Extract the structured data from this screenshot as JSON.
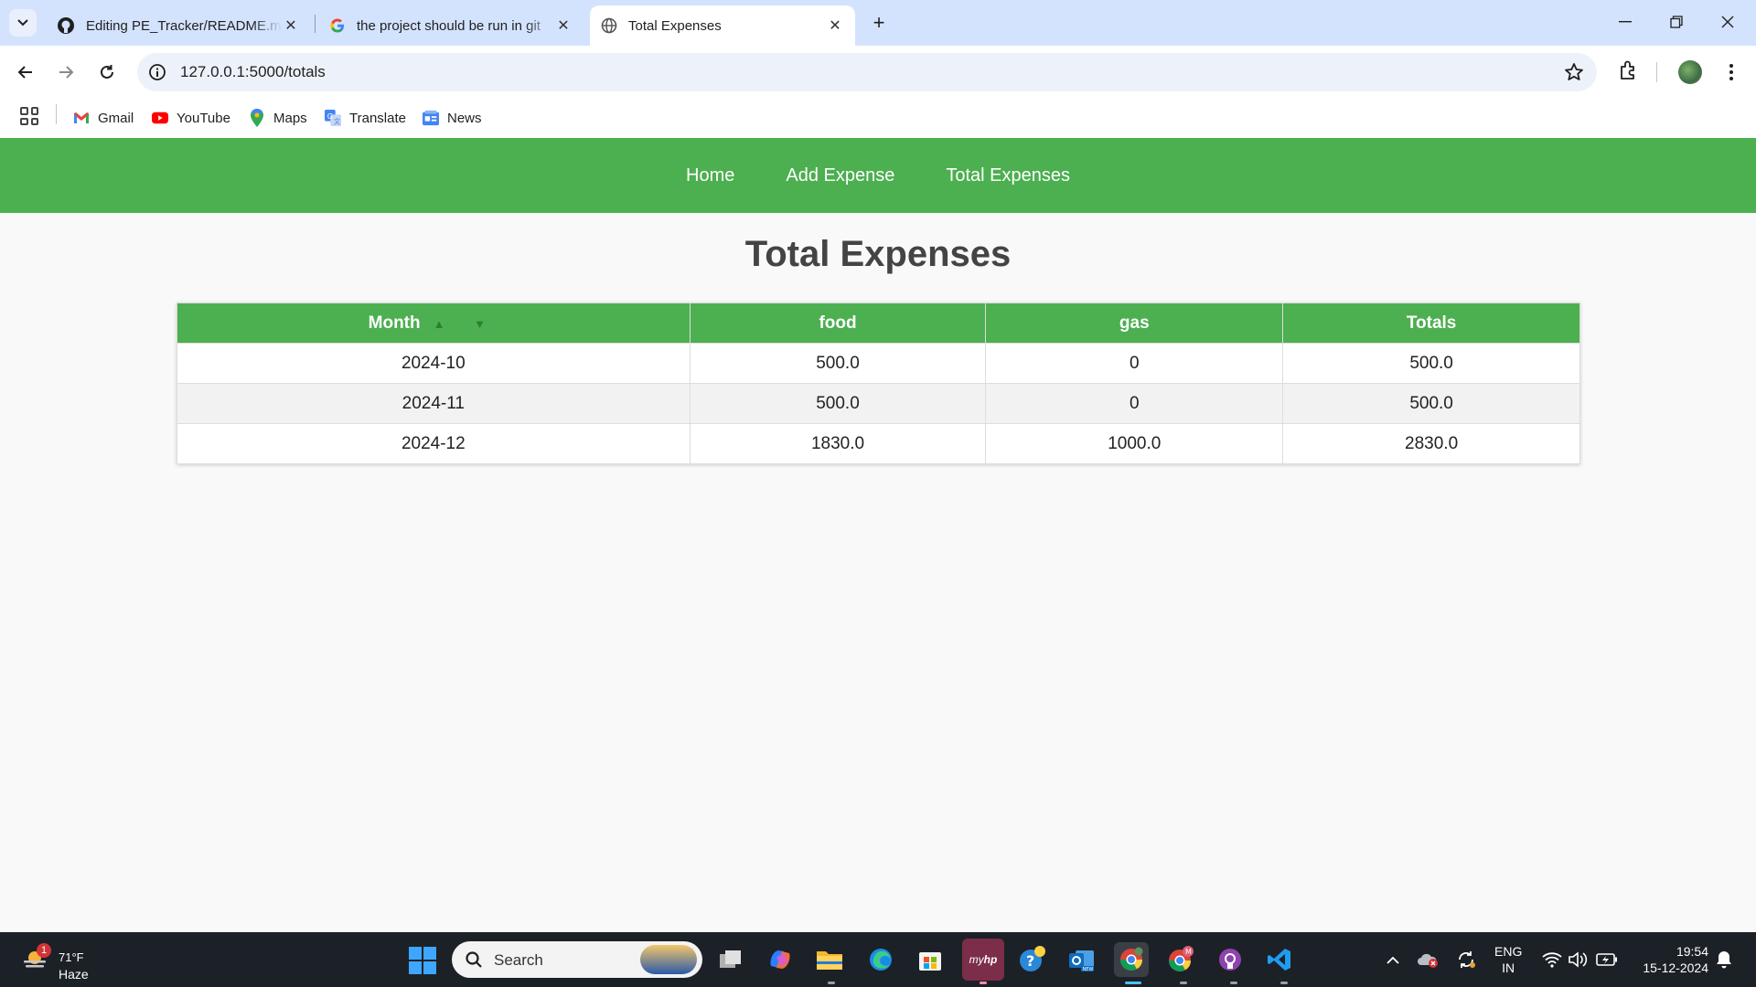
{
  "browser": {
    "tabs": [
      {
        "title": "Editing PE_Tracker/README.md",
        "icon": "github-icon"
      },
      {
        "title": "the project should be run in git",
        "icon": "google-icon"
      },
      {
        "title": "Total Expenses",
        "icon": "globe-icon",
        "active": true
      }
    ],
    "url": "127.0.0.1:5000/totals",
    "bookmarks": [
      {
        "label": "Gmail",
        "icon": "gmail-icon"
      },
      {
        "label": "YouTube",
        "icon": "youtube-icon"
      },
      {
        "label": "Maps",
        "icon": "maps-icon"
      },
      {
        "label": "Translate",
        "icon": "translate-icon"
      },
      {
        "label": "News",
        "icon": "news-icon"
      }
    ]
  },
  "site": {
    "nav": [
      "Home",
      "Add Expense",
      "Total Expenses"
    ],
    "title": "Total Expenses",
    "accent": "#4caf50",
    "table": {
      "headers": [
        "Month",
        "food",
        "gas",
        "Totals"
      ],
      "sort_icons": "▲ ▼",
      "rows": [
        [
          "2024-10",
          "500.0",
          "0",
          "500.0"
        ],
        [
          "2024-11",
          "500.0",
          "0",
          "500.0"
        ],
        [
          "2024-12",
          "1830.0",
          "1000.0",
          "2830.0"
        ]
      ]
    }
  },
  "taskbar": {
    "weather": {
      "temp": "71°F",
      "condition": "Haze",
      "badge": "1"
    },
    "search_placeholder": "Search",
    "language": [
      "ENG",
      "IN"
    ],
    "time": "19:54",
    "date": "15-12-2024"
  }
}
